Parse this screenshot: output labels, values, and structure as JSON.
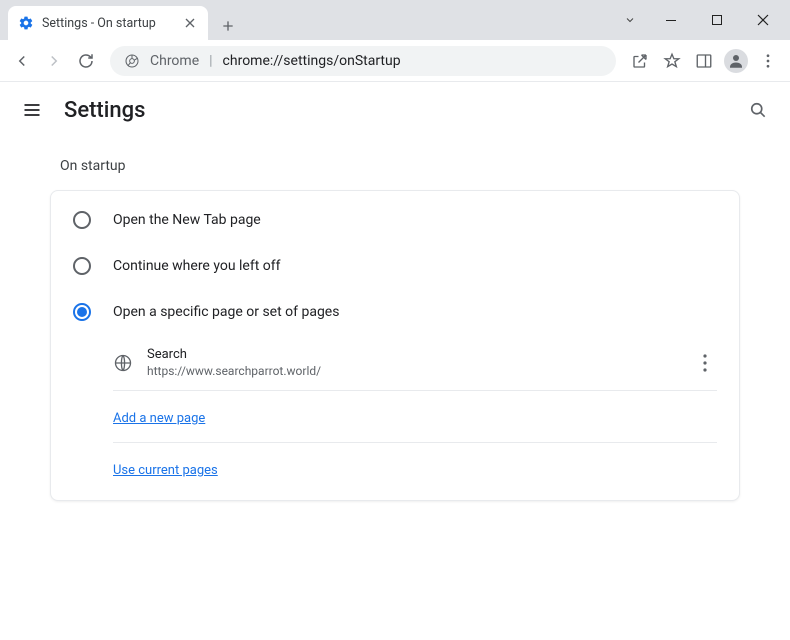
{
  "tab": {
    "title": "Settings - On startup"
  },
  "omnibox": {
    "prefix": "Chrome",
    "path": "chrome://settings/onStartup"
  },
  "header": {
    "title": "Settings"
  },
  "section": {
    "title": "On startup",
    "options": [
      {
        "label": "Open the New Tab page",
        "selected": false
      },
      {
        "label": "Continue where you left off",
        "selected": false
      },
      {
        "label": "Open a specific page or set of pages",
        "selected": true
      }
    ],
    "pages": [
      {
        "name": "Search",
        "url": "https://www.searchparrot.world/"
      }
    ],
    "add_link": "Add a new page",
    "use_link": "Use current pages"
  }
}
